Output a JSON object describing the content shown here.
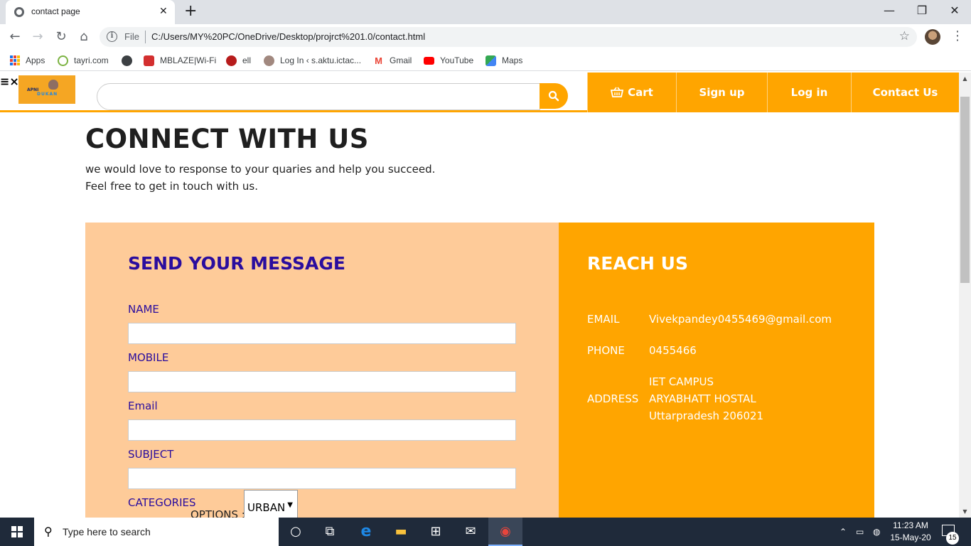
{
  "browser": {
    "tab_title": "contact page",
    "tab_close": "✕",
    "new_tab": "+",
    "window_controls": {
      "minimize": "—",
      "restore": "❐",
      "close": "✕"
    },
    "nav": {
      "back": "←",
      "forward": "→",
      "reload": "↻",
      "home": "⌂"
    },
    "address": {
      "info_icon": "i",
      "scheme": "File",
      "url": "C:/Users/MY%20PC/OneDrive/Desktop/projrct%201.0/contact.html"
    },
    "star": "☆",
    "menu": "⋮",
    "bookmarks": [
      {
        "label": "Apps",
        "icon": "apps-grid"
      },
      {
        "label": "tayri.com",
        "icon": "tayri-icon",
        "color": "#7cb342"
      },
      {
        "label": "",
        "icon": "globe-icon",
        "color": "#3c4043"
      },
      {
        "label": "MBLAZE|Wi-Fi",
        "icon": "mblaze-icon",
        "color": "#d32f2f"
      },
      {
        "label": "ell",
        "icon": "ell-icon",
        "color": "#b71c1c"
      },
      {
        "label": "Log In ‹ s.aktu.ictac...",
        "icon": "aktu-icon",
        "color": "#8d6e63"
      },
      {
        "label": "Gmail",
        "icon": "gmail-icon",
        "color": "#ea4335"
      },
      {
        "label": "YouTube",
        "icon": "youtube-icon",
        "color": "#ff0000"
      },
      {
        "label": "Maps",
        "icon": "maps-icon",
        "color": "#34a853"
      }
    ]
  },
  "site": {
    "accent": "#ffa500",
    "header": {
      "hamburger": "≡×",
      "logo_line1": "APNI",
      "logo_line2": "DUKAN",
      "search_placeholder": "",
      "nav": [
        {
          "label": "Cart",
          "icon": "cart-icon"
        },
        {
          "label": "Sign up"
        },
        {
          "label": "Log in"
        },
        {
          "label": "Contact Us"
        }
      ]
    },
    "hero": {
      "title": "CONNECT WITH US",
      "line1": "we would love to response to your quaries and help you succeed.",
      "line2": "Feel free to get in touch with us."
    },
    "form": {
      "title": "SEND YOUR MESSAGE",
      "title_color": "#2a0d9e",
      "bg": "#fecb99",
      "fields": [
        {
          "label": "NAME",
          "value": ""
        },
        {
          "label": "MOBILE",
          "value": ""
        },
        {
          "label": "Email",
          "value": ""
        },
        {
          "label": "SUBJECT",
          "value": ""
        }
      ],
      "categories_label": "CATEGORIES",
      "options_label": "OPTIONS :",
      "select_value": "URBAN"
    },
    "reach": {
      "title": "REACH US",
      "email_label": "EMAIL",
      "email": "Vivekpandey0455469@gmail.com",
      "phone_label": "PHONE",
      "phone": "0455466",
      "address_label": "ADDRESS",
      "address_lines": [
        "IET CAMPUS",
        "ARYABHATT HOSTAL",
        "Uttarpradesh 206021"
      ]
    }
  },
  "taskbar": {
    "search_text": "Type here to search",
    "apps": [
      {
        "name": "cortana-icon",
        "glyph": "○"
      },
      {
        "name": "task-view-icon",
        "glyph": "⧉"
      },
      {
        "name": "edge-icon",
        "glyph": "e"
      },
      {
        "name": "file-explorer-icon",
        "glyph": "▬"
      },
      {
        "name": "store-icon",
        "glyph": "⊞"
      },
      {
        "name": "mail-icon",
        "glyph": "✉"
      },
      {
        "name": "chrome-icon",
        "glyph": "◉"
      }
    ],
    "time": "11:23 AM",
    "date": "15-May-20",
    "notification_count": "15"
  }
}
